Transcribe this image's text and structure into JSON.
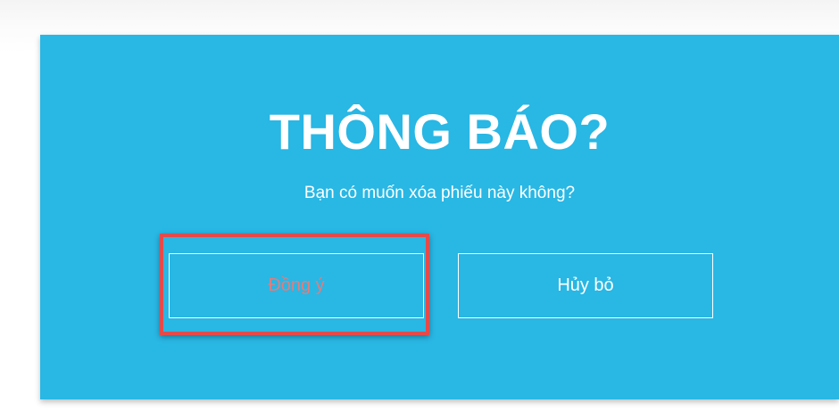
{
  "dialog": {
    "title": "THÔNG BÁO?",
    "message": "Bạn có muốn xóa phiếu này không?",
    "confirm_label": "Đồng ý",
    "cancel_label": "Hủy bỏ"
  },
  "colors": {
    "dialog_background": "#29b7e4",
    "text": "#ffffff",
    "confirm_text": "#e27d7d",
    "highlight": "#e34b4b"
  }
}
